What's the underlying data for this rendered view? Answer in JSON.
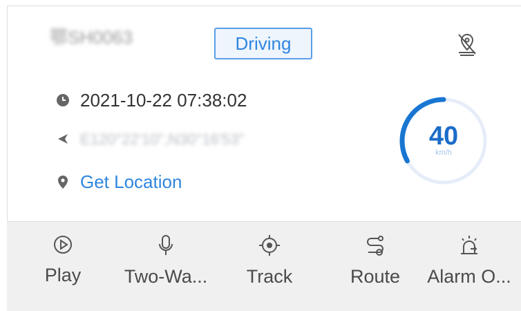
{
  "vehicle": {
    "plate": "鄂SH0063",
    "status": "Driving"
  },
  "info": {
    "timestamp": "2021-10-22 07:38:02",
    "coordinates": "E120°22'10\",N30°16'53\"",
    "location_link": "Get Location"
  },
  "speed": {
    "value": "40",
    "unit": "km/h",
    "fraction": 0.33
  },
  "actions": [
    {
      "label": "Play",
      "icon": "play-icon"
    },
    {
      "label": "Two-Wa...",
      "icon": "microphone-icon"
    },
    {
      "label": "Track",
      "icon": "target-icon"
    },
    {
      "label": "Route",
      "icon": "route-icon"
    },
    {
      "label": "Alarm O...",
      "icon": "alarm-icon"
    }
  ],
  "colors": {
    "accent": "#2f86e0",
    "speed_arc": "#1976d2",
    "action_bar_bg": "#f0f0f0",
    "icon_gray": "#555555"
  }
}
